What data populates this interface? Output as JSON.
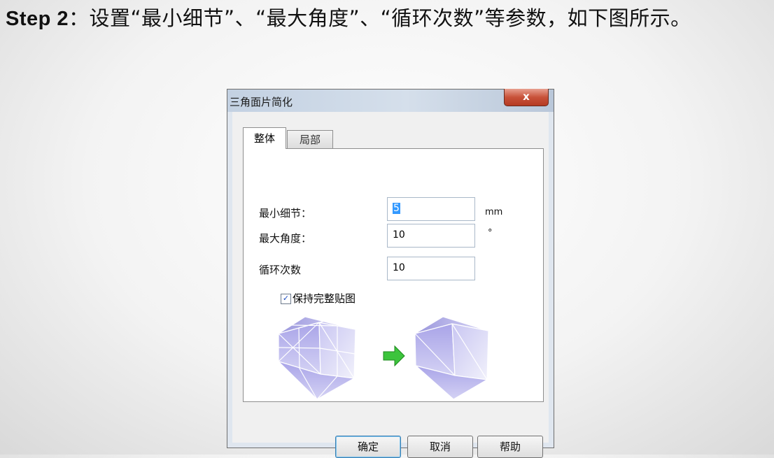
{
  "caption": {
    "step": "Step 2",
    "text": "：设置“最小细节”、“最大角度”、“循环次数”等参数，如下图所示。"
  },
  "dialog": {
    "title": "三角面片简化",
    "close_label": "x",
    "tabs": [
      {
        "label": "整体",
        "active": true
      },
      {
        "label": "局部",
        "active": false
      }
    ],
    "fields": [
      {
        "label": "最小细节：",
        "value": "5",
        "unit": "mm",
        "selected": true
      },
      {
        "label": "最大角度：",
        "value": "10",
        "unit": "°"
      },
      {
        "label": "循环次数",
        "value": "10",
        "unit": ""
      }
    ],
    "checkbox": {
      "label": "保持完整贴图",
      "checked": true
    },
    "buttons": {
      "ok": "确定",
      "cancel": "取消",
      "help": "帮助"
    },
    "colors": {
      "arrow": "#3cc43c",
      "mesh": "#b9b6ee"
    }
  }
}
